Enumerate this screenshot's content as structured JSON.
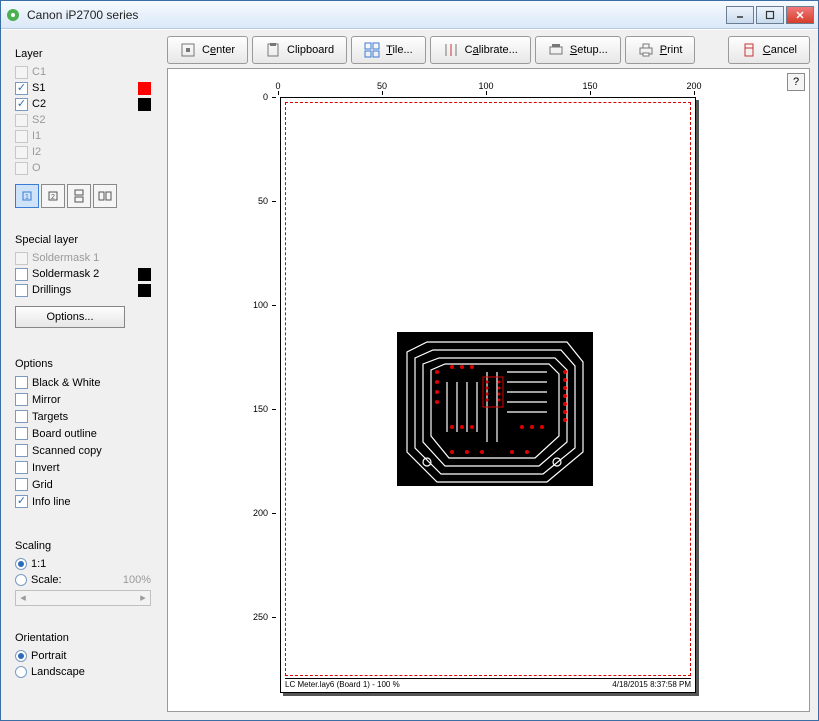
{
  "title": "Canon iP2700 series",
  "toolbar": {
    "center": "Center",
    "center_u": "e",
    "clipboard": "Clipboard",
    "tile": "Tile...",
    "tile_u": "T",
    "calibrate": "Calibrate...",
    "calibrate_u": "a",
    "setup": "Setup...",
    "setup_u": "S",
    "print": "Print",
    "print_u": "P",
    "cancel": "Cancel",
    "cancel_u": "C"
  },
  "sidebar": {
    "layer_title": "Layer",
    "layers": [
      {
        "name": "C1",
        "checked": false,
        "disabled": true
      },
      {
        "name": "S1",
        "checked": true,
        "color": "#ff0000"
      },
      {
        "name": "C2",
        "checked": true,
        "color": "#000000"
      },
      {
        "name": "S2",
        "checked": false,
        "disabled": true
      },
      {
        "name": "I1",
        "checked": false,
        "disabled": true
      },
      {
        "name": "I2",
        "checked": false,
        "disabled": true
      },
      {
        "name": "O",
        "checked": false,
        "disabled": true
      }
    ],
    "special_title": "Special layer",
    "special": [
      {
        "name": "Soldermask 1",
        "checked": false,
        "disabled": true
      },
      {
        "name": "Soldermask 2",
        "checked": false,
        "color": "#000000"
      },
      {
        "name": "Drillings",
        "checked": false,
        "color": "#000000"
      }
    ],
    "options_btn": "Options...",
    "options_title": "Options",
    "options": [
      {
        "name": "Black & White",
        "checked": false
      },
      {
        "name": "Mirror",
        "checked": false
      },
      {
        "name": "Targets",
        "checked": false
      },
      {
        "name": "Board outline",
        "checked": false
      },
      {
        "name": "Scanned copy",
        "checked": false
      },
      {
        "name": "Invert",
        "checked": false
      },
      {
        "name": "Grid",
        "checked": false
      },
      {
        "name": "Info line",
        "checked": true
      }
    ],
    "scaling_title": "Scaling",
    "scaling": {
      "one_to_one": "1:1",
      "scale": "Scale:",
      "pct": "100%",
      "selected": "one_to_one"
    },
    "orientation_title": "Orientation",
    "orientation": {
      "portrait": "Portrait",
      "landscape": "Landscape",
      "selected": "portrait"
    }
  },
  "preview": {
    "ruler_h": [
      0,
      50,
      100,
      150,
      200
    ],
    "ruler_v": [
      0,
      50,
      100,
      150,
      200,
      250
    ],
    "status_left": "LC Meter.lay6 (Board 1) - 100 %",
    "status_right": "4/18/2015 8:37:58 PM"
  },
  "help": "?"
}
